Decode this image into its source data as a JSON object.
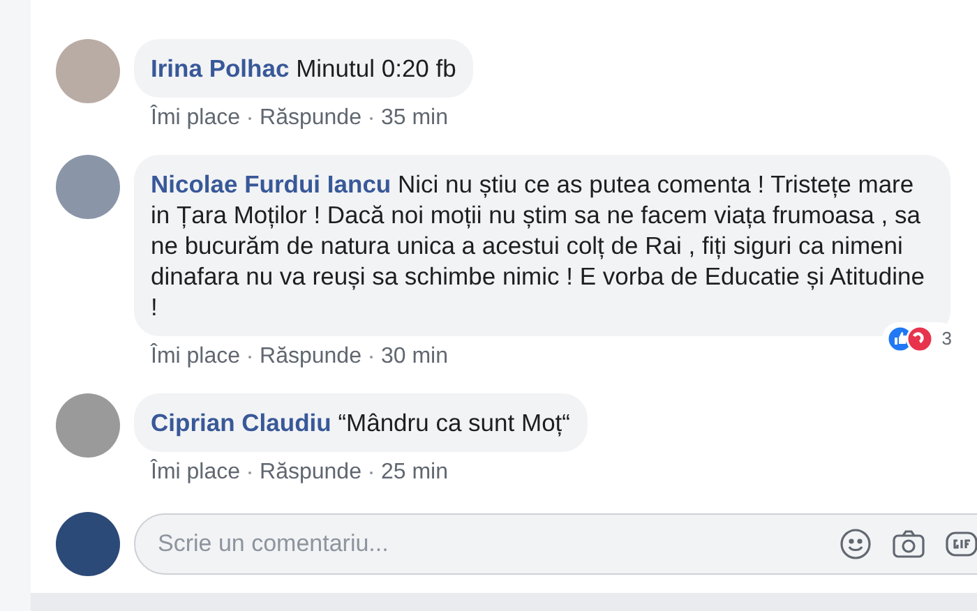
{
  "comments": [
    {
      "author": "Irina Polhac",
      "text": "Minutul 0:20 fb",
      "actions": [
        "Îmi place",
        "Răspunde",
        "35 min"
      ]
    },
    {
      "author": "Nicolae Furdui Iancu",
      "text": "Nici nu știu ce as putea comenta ! Tristețe mare in Țara Moților ! Dacă noi moții nu știm sa ne facem viața frumoasa , sa ne bucurăm de natura unica a acestui colț de Rai , fiți siguri ca nimeni dinafara nu va reuși sa schimbe nimic ! E vorba de Educatie și Atitudine !",
      "actions": [
        "Îmi place",
        "Răspunde",
        "30 min"
      ],
      "reactions": {
        "count": "3"
      }
    },
    {
      "author": "Ciprian Claudiu",
      "text": "“Mândru ca sunt Moț“",
      "actions": [
        "Îmi place",
        "Răspunde",
        "25 min"
      ]
    }
  ],
  "composer": {
    "placeholder": "Scrie un comentariu..."
  }
}
